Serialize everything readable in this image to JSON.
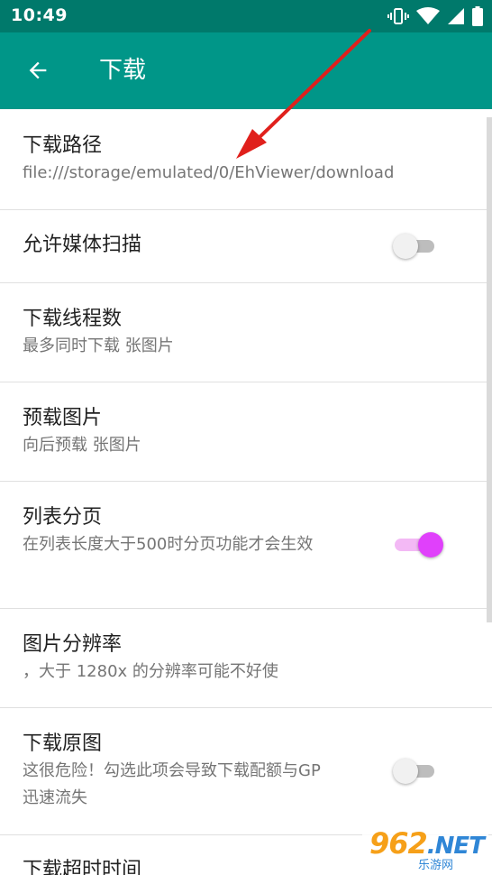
{
  "status_bar": {
    "time": "10:49",
    "icons": [
      "vibrate-icon",
      "wifi-icon",
      "signal-icon",
      "battery-icon"
    ]
  },
  "toolbar": {
    "title": "下载",
    "back_icon": "arrow-left-icon",
    "background": "#009688"
  },
  "preferences": [
    {
      "key": "path",
      "title": "下载路径",
      "summary": "file:///storage/emulated/0/EhViewer/download"
    },
    {
      "key": "media_scan",
      "title": "允许媒体扫描",
      "switch": false
    },
    {
      "key": "threads",
      "title": "下载线程数",
      "summary": "最多同时下载  张图片"
    },
    {
      "key": "preload",
      "title": "预载图片",
      "summary": "向后预载  张图片"
    },
    {
      "key": "paging",
      "title": "列表分页",
      "summary": "在列表长度大于500时分页功能才会生效",
      "switch": true
    },
    {
      "key": "resolution",
      "title": "图片分辨率",
      "summary": "，大于 1280x 的分辨率可能不好使"
    },
    {
      "key": "original",
      "title": "下载原图",
      "summary": "这很危险！勾选此项会导致下载配额与GP迅速流失",
      "switch": false
    },
    {
      "key": "timeout",
      "title": "下载超时时间"
    }
  ],
  "colors": {
    "status_bar": "#00796b",
    "toolbar": "#009688",
    "switch_on_thumb": "#e040fb",
    "switch_on_track": "#f3b9f5",
    "switch_off_thumb": "#f1f1f1",
    "switch_off_track": "#bdbdbd",
    "annotation_arrow": "#e0201c"
  },
  "watermark": {
    "logo_digits": "962",
    "logo_suffix": ".NET",
    "subtitle": "乐游网"
  }
}
